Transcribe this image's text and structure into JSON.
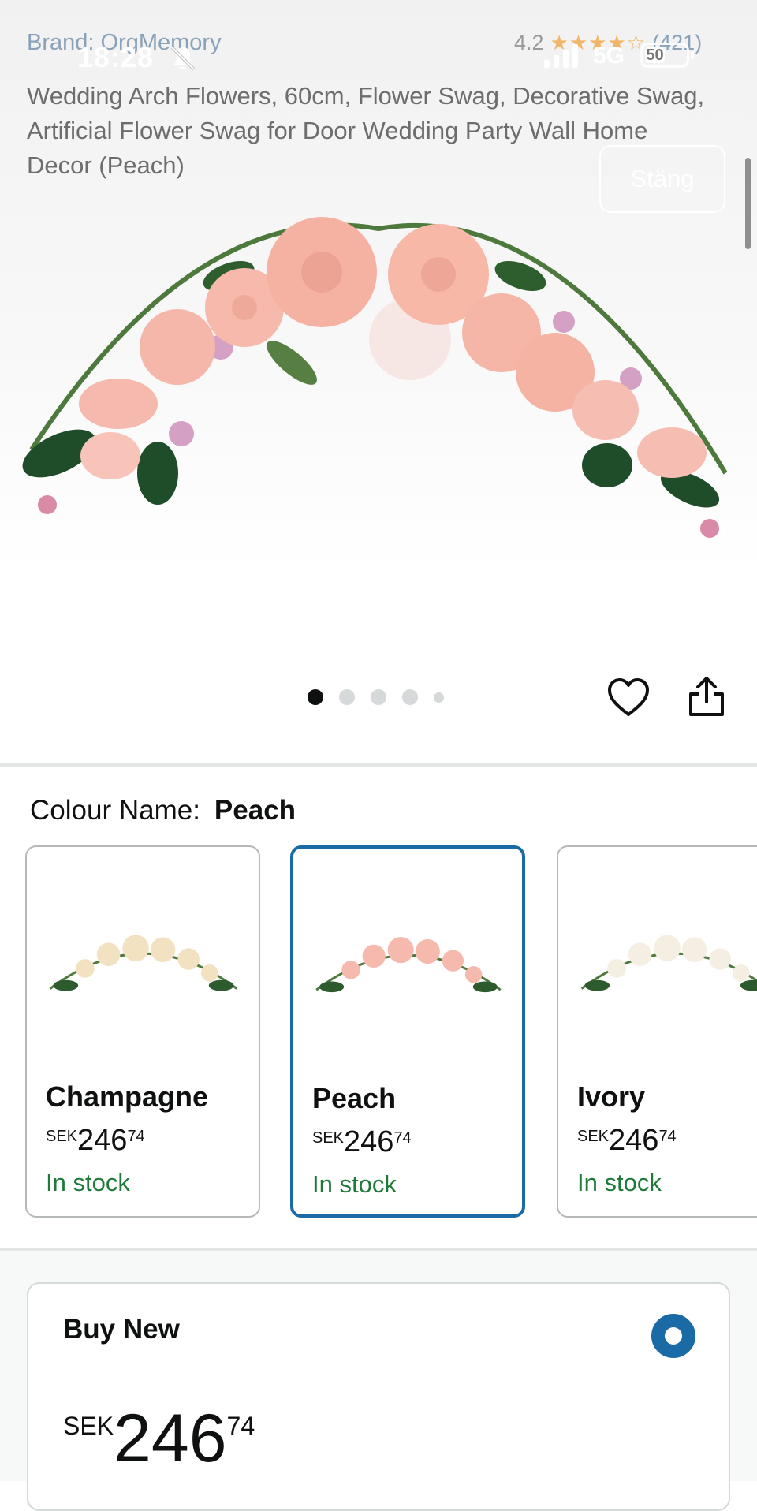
{
  "status_bar": {
    "time": "18:28",
    "network": "5G",
    "battery": "50",
    "battery_fraction": 0.5
  },
  "product": {
    "brand_label": "Brand: OrgMemory",
    "rating": "4.2",
    "rating_count": "(421)",
    "stars": "★★★★☆",
    "title": "Wedding Arch Flowers, 60cm, Flower Swag, Decorative Swag, Artificial Flower Swag for Door Wedding Party Wall Home Decor (Peach)"
  },
  "overlay": {
    "close_label": "Stäng"
  },
  "carousel": {
    "count": 5,
    "active_index": 0
  },
  "colour": {
    "label": "Colour Name:",
    "selected": "Peach"
  },
  "variants": [
    {
      "name": "Champagne",
      "currency": "SEK",
      "price_whole": "246",
      "price_fraction": "74",
      "stock": "In stock",
      "selected": false,
      "petal": "#f3e2c2"
    },
    {
      "name": "Peach",
      "currency": "SEK",
      "price_whole": "246",
      "price_fraction": "74",
      "stock": "In stock",
      "selected": true,
      "petal": "#f5b9ad"
    },
    {
      "name": "Ivory",
      "currency": "SEK",
      "price_whole": "246",
      "price_fraction": "74",
      "stock": "In stock",
      "selected": false,
      "petal": "#f4efe2"
    }
  ],
  "buy_new": {
    "label": "Buy New",
    "currency": "SEK",
    "price_whole": "246",
    "price_fraction": "74"
  },
  "colors": {
    "accent": "#1a6aa6",
    "in_stock": "#1f7a3a",
    "link": "#8aa2b9"
  }
}
